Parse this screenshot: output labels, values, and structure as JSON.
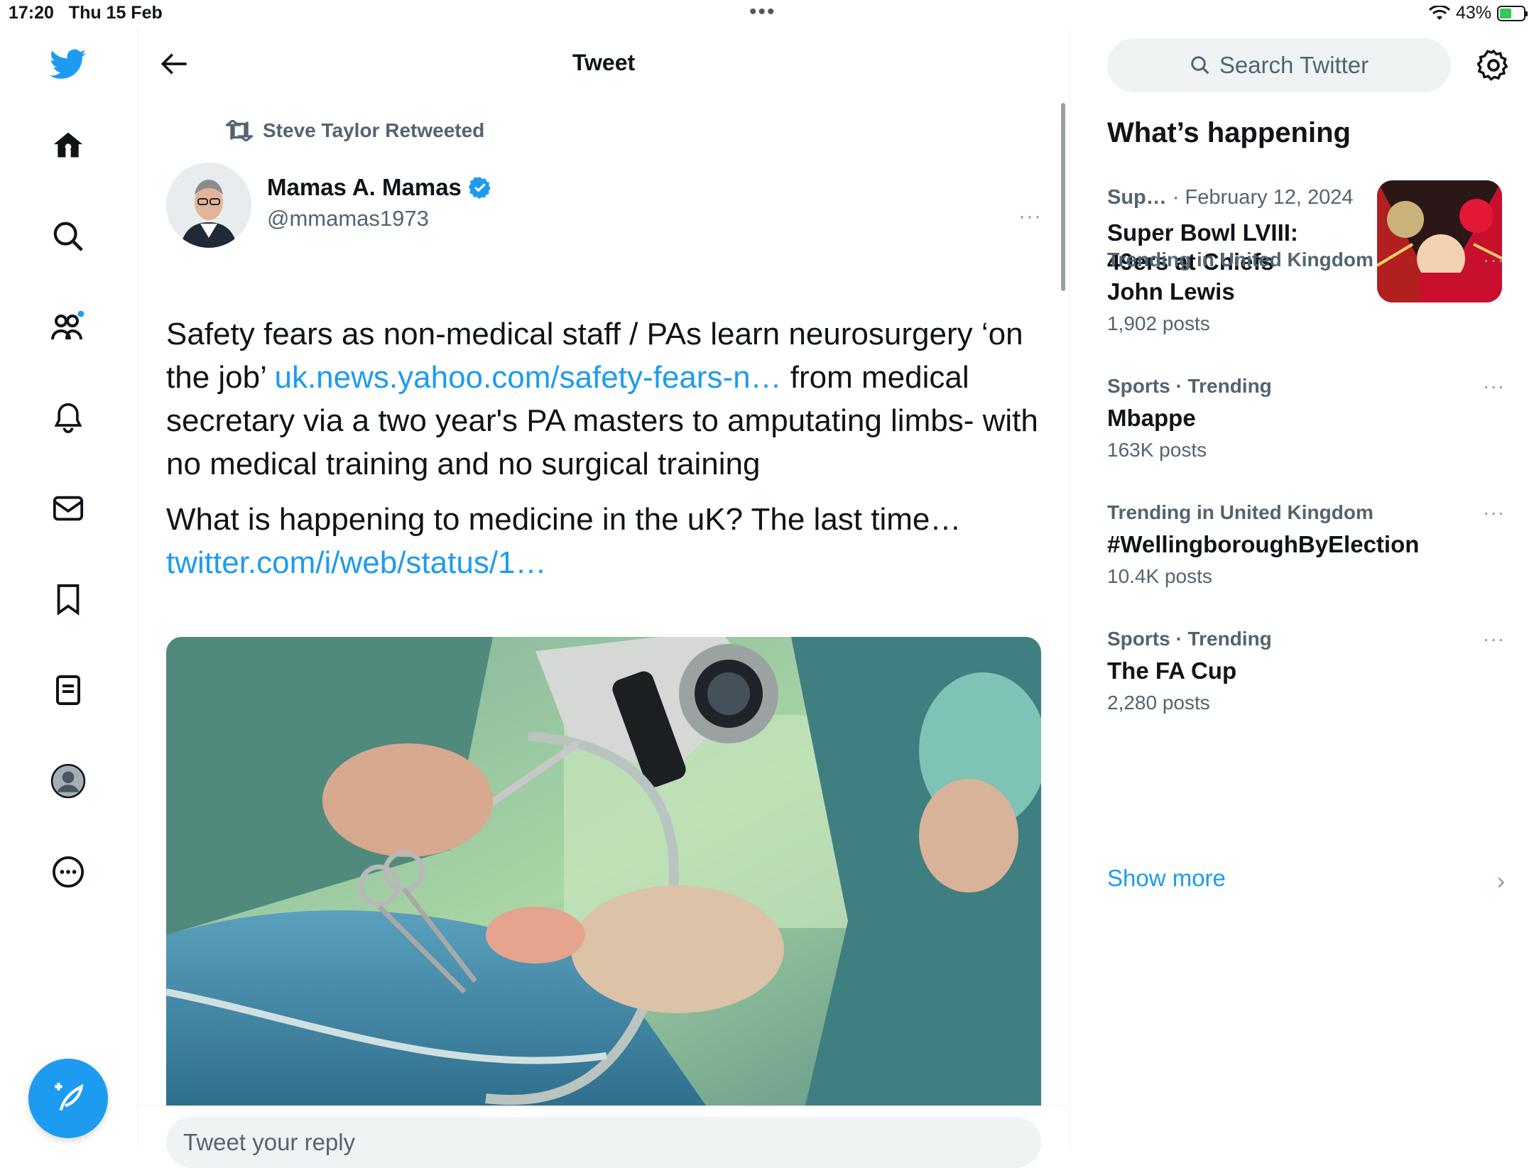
{
  "status_bar": {
    "time": "17:20",
    "date": "Thu 15 Feb",
    "battery": "43%"
  },
  "nav": {
    "items": [
      "twitter-logo",
      "home",
      "explore",
      "communities",
      "notifications",
      "messages",
      "bookmarks",
      "lists",
      "profile",
      "more"
    ],
    "compose_label": "Tweet"
  },
  "header": {
    "title": "Tweet"
  },
  "tweet": {
    "retweeted_by": "Steve Taylor Retweeted",
    "author_name": "Mamas A. Mamas",
    "author_handle": "@mmamas1973",
    "more": "···",
    "text_p1_a": "Safety fears as non-medical staff / PAs learn neurosurgery ‘on the job’ ",
    "text_p1_link": "uk.news.yahoo.com/safety-fears-n…",
    "text_p1_b": " from medical secretary via a two year's PA masters to amputating limbs- with no medical training and no surgical training",
    "text_p2_a": "What is happening to medicine in the uK? The last time…",
    "text_p2_link": "twitter.com/i/web/status/1…"
  },
  "reply": {
    "placeholder": "Tweet your reply"
  },
  "sidebar": {
    "search_placeholder": "Search Twitter",
    "section_title": "What’s happening",
    "featured": {
      "category": "Sup…",
      "date": " · February 12, 2024",
      "title": "Super Bowl LVIII: 49ers at Chiefs"
    },
    "trends": [
      {
        "meta": "Trending in United Kingdom",
        "name": "John Lewis",
        "count": "1,902 posts"
      },
      {
        "meta": "Sports · Trending",
        "name": "Mbappe",
        "count": "163K posts"
      },
      {
        "meta": "Trending in United Kingdom",
        "name": "#WellingboroughByElection",
        "count": "10.4K posts"
      },
      {
        "meta": "Sports · Trending",
        "name": "The FA Cup",
        "count": "2,280 posts"
      }
    ],
    "trend_more": "···",
    "show_more": "Show more"
  },
  "colors": {
    "accent": "#1d9bf0",
    "text": "#0f1419",
    "muted": "#536471"
  }
}
